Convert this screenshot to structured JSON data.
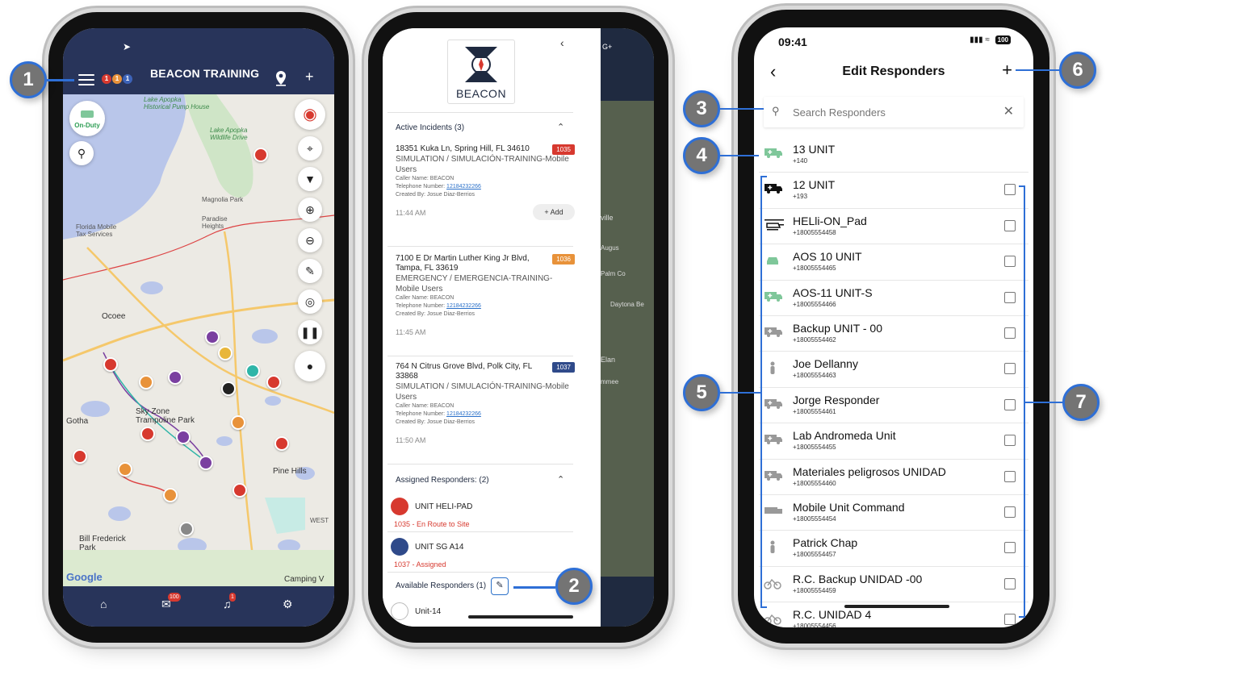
{
  "colors": {
    "navy": "#28345a",
    "accent_blue": "#2e6fd6",
    "callout_gray": "#747474",
    "red": "#d7392f"
  },
  "phone1": {
    "title": "BEACON TRAINING",
    "badges": [
      "1",
      "1",
      "1"
    ],
    "on_duty_label": "On-Duty",
    "map_labels": {
      "lake_apopka_pump": "Lake Apopka\nHistorical Pump House",
      "lake_apopka_wildlife": "Lake Apopka\nWildlife Drive",
      "magnolia_park": "Magnolia Park",
      "paradise_heights": "Paradise\nHeights",
      "florida_mobile": "Florida Mobile\nTax Services",
      "ocoee": "Ocoee",
      "sky_zone": "Sky Zone\nTrampoline Park",
      "gotha": "Gotha",
      "pine_hills": "Pine Hills",
      "bill_frederick": "Bill Frederick\nPark",
      "camping": "Camping V",
      "west": "WEST",
      "google": "Google"
    },
    "tabbar": {
      "messages_badge": "100",
      "alerts_badge": "1"
    }
  },
  "phone2": {
    "logo_text": "BEACON",
    "active_incidents_header": "Active Incidents (3)",
    "incidents": [
      {
        "address": "18351 Kuka Ln, Spring Hill, FL 34610",
        "type": "SIMULATION / SIMULACIÓN-TRAINING-Mobile Users",
        "caller": "Caller Name: BEACON",
        "phone_label": "Telephone Number:",
        "phone": "12184232266",
        "created_by": "Created By: Josue Diaz-Berrios",
        "time": "11:44 AM",
        "number": "1035",
        "number_color": "#d7392f",
        "add_label": "Add"
      },
      {
        "address": "7100 E Dr Martin Luther King Jr Blvd, Tampa, FL 33619",
        "type": "EMERGENCY / EMERGENCIA-TRAINING-Mobile Users",
        "caller": "Caller Name: BEACON",
        "phone_label": "Telephone Number:",
        "phone": "12184232266",
        "created_by": "Created By: Josue Diaz-Berrios",
        "time": "11:45 AM",
        "number": "1036",
        "number_color": "#e8923a"
      },
      {
        "address": "764 N Citrus Grove Blvd, Polk City, FL 33868",
        "type": "SIMULATION / SIMULACIÓN-TRAINING-Mobile Users",
        "caller": "Caller Name: BEACON",
        "phone_label": "Telephone Number:",
        "phone": "12184232266",
        "created_by": "Created By: Josue Diaz-Berrios",
        "time": "11:50 AM",
        "number": "1037",
        "number_color": "#2f4a8a"
      }
    ],
    "assigned_header": "Assigned Responders: (2)",
    "assigned": [
      {
        "name": "UNIT HELI-PAD",
        "status": "1035 - En Route to Site"
      },
      {
        "name": "UNIT SG A14",
        "status": "1037 - Assigned"
      }
    ],
    "available_header": "Available Responders (1)",
    "available": [
      {
        "name": "Unit-14"
      }
    ],
    "behind_labels": [
      "G+",
      "ville",
      "Augus",
      "Palm Co",
      "Daytona Be",
      "Elan",
      "mmee"
    ]
  },
  "phone3": {
    "status_time": "09:41",
    "battery": "100",
    "title": "Edit Responders",
    "search_placeholder": "Search Responders",
    "responders": [
      {
        "name": "13 UNIT",
        "phone": "+140",
        "icon": "ambulance-icon",
        "color": "#7fc79a",
        "checkbox": false
      },
      {
        "name": "12 UNIT",
        "phone": "+193",
        "icon": "ambulance-icon",
        "color": "#111111",
        "checkbox": true
      },
      {
        "name": "HELli-ON_Pad",
        "phone": "+18005554458",
        "icon": "helicopter-icon",
        "color": "#111111",
        "checkbox": true
      },
      {
        "name": "AOS 10 UNIT",
        "phone": "+18005554465",
        "icon": "car-icon",
        "color": "#7fc79a",
        "checkbox": true
      },
      {
        "name": "AOS-11 UNIT-S",
        "phone": "+18005554466",
        "icon": "ambulance-icon",
        "color": "#7fc79a",
        "checkbox": true
      },
      {
        "name": "Backup UNIT - 00",
        "phone": "+18005554462",
        "icon": "ambulance-icon",
        "color": "#999999",
        "checkbox": true
      },
      {
        "name": "Joe Dellanny",
        "phone": "+18005554463",
        "icon": "person-icon",
        "color": "#999999",
        "checkbox": true
      },
      {
        "name": "Jorge Responder",
        "phone": "+18005554461",
        "icon": "ambulance-icon",
        "color": "#999999",
        "checkbox": true
      },
      {
        "name": "Lab Andromeda Unit",
        "phone": "+18005554455",
        "icon": "ambulance-icon",
        "color": "#999999",
        "checkbox": true
      },
      {
        "name": "Materiales peligrosos UNIDAD",
        "phone": "+18005554460",
        "icon": "ambulance-icon",
        "color": "#999999",
        "checkbox": true
      },
      {
        "name": "Mobile Unit Command",
        "phone": "+18005554454",
        "icon": "truck-icon",
        "color": "#999999",
        "checkbox": true
      },
      {
        "name": "Patrick Chap",
        "phone": "+18005554457",
        "icon": "person-icon",
        "color": "#999999",
        "checkbox": true
      },
      {
        "name": "R.C. Backup UNIDAD -00",
        "phone": "+18005554459",
        "icon": "bicycle-icon",
        "color": "#999999",
        "checkbox": true
      },
      {
        "name": "R.C. UNIDAD 4",
        "phone": "+18005554456",
        "icon": "bicycle-icon",
        "color": "#999999",
        "checkbox": true
      }
    ]
  },
  "callouts": [
    "1",
    "2",
    "3",
    "4",
    "5",
    "6",
    "7"
  ]
}
